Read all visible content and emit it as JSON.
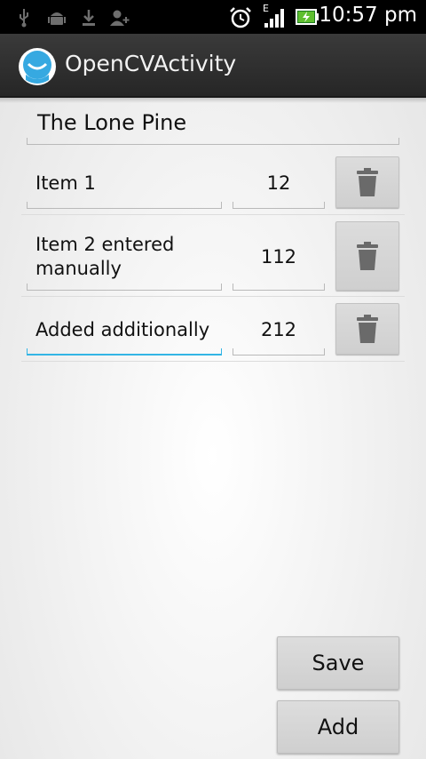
{
  "status_bar": {
    "time": "10:57 pm",
    "network_label": "E",
    "icons": [
      "usb-icon",
      "android-debug-icon",
      "download-icon",
      "add-contact-icon",
      "alarm-icon",
      "signal-icon",
      "battery-charging-icon"
    ]
  },
  "action_bar": {
    "title": "OpenCVActivity",
    "icon": "app-icon"
  },
  "list": {
    "name": "The Lone Pine",
    "items": [
      {
        "name": "Item 1",
        "quantity": "12"
      },
      {
        "name_line1": "Item 2 entered",
        "name_line2": "manually",
        "quantity": "112"
      },
      {
        "name": "Added additionally",
        "quantity": "212"
      }
    ]
  },
  "buttons": {
    "save": "Save",
    "add": "Add"
  },
  "colors": {
    "focus_accent": "#33b5e5",
    "action_bar": "#2e2e2e"
  }
}
